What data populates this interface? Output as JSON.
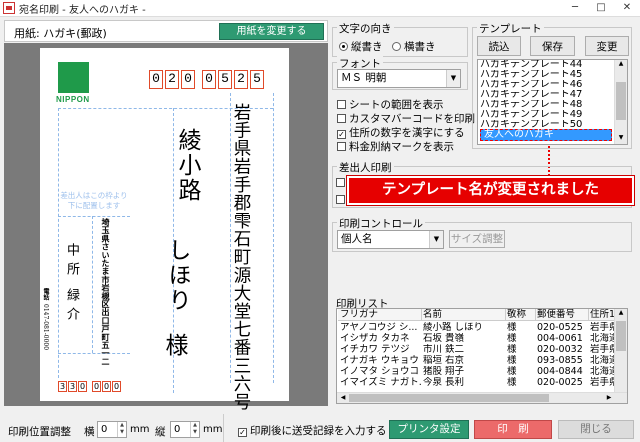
{
  "window": {
    "title": "宛名印刷 - 友人へのハガキ -",
    "controls": [
      "─",
      "□",
      "✕"
    ]
  },
  "preview": {
    "paper_label": "用紙: ハガキ(郵政)",
    "change_paper_button": "用紙を変更する",
    "logo_text": "NIPPON",
    "zip_digits": [
      "0",
      "2",
      "0",
      "0",
      "5",
      "2",
      "5"
    ],
    "address": "岩手県岩手郡雫石町源大堂七番三六号",
    "recipient_name_1": "綾小路",
    "recipient_name_2": "しほり",
    "honorific": "様",
    "guide_text": "差出人はこの枠より下に配置します",
    "sender_address": "埼玉県さいたま市岩槻区出口戸町五一二",
    "sender_name_1": "中所",
    "sender_name_2": "緑介",
    "side_text_1": "電話",
    "side_text_2": "0147-081-0000",
    "sender_zip": [
      "3",
      "3",
      "0",
      "0",
      "0",
      "0"
    ]
  },
  "direction": {
    "label": "文字の向き",
    "option_vertical": "縦書き",
    "option_horizontal": "横書き",
    "selected": "vertical"
  },
  "font": {
    "label": "フォント",
    "value": "ＭＳ 明朝"
  },
  "options": [
    {
      "label": "シートの範囲を表示",
      "checked": false
    },
    {
      "label": "カスタマバーコードを印刷",
      "checked": false
    },
    {
      "label": "住所の数字を漢字にする",
      "checked": true
    },
    {
      "label": "料金別納マークを表示",
      "checked": false
    }
  ],
  "template": {
    "label": "テンプレート",
    "load_button": "読込",
    "save_button": "保存",
    "change_button": "変更",
    "items": [
      "ハガキテンプレート44",
      "ハガキテンプレート45",
      "ハガキテンプレート46",
      "ハガキテンプレート47",
      "ハガキテンプレート48",
      "ハガキテンプレート49",
      "ハガキテンプレート50"
    ],
    "selected": "友人へのハガキ"
  },
  "notification": "テンプレート名が変更されました",
  "sender": {
    "label": "差出人印刷"
  },
  "print_control": {
    "label": "印刷コントロール",
    "mode": "個人名",
    "size_adjust_button": "サイズ調整"
  },
  "print_list": {
    "label": "印刷リスト",
    "columns": [
      "フリガナ",
      "名前",
      "敬称",
      "郵便番号",
      "住所1"
    ],
    "rows": [
      [
        "アヤノコウジ シ...",
        "綾小路 しほり",
        "様",
        "020-0525",
        "岩手県"
      ],
      [
        "イシザカ タカネ",
        "石坂 貴嶺",
        "様",
        "004-0061",
        "北海道"
      ],
      [
        "イチカワ テツジ",
        "市川 鉄二",
        "様",
        "020-0032",
        "岩手県"
      ],
      [
        "イナガキ ウキョウ",
        "稲垣 右京",
        "様",
        "093-0855",
        "北海道"
      ],
      [
        "イノマタ ショウコ",
        "猪股 翔子",
        "様",
        "004-0844",
        "北海道"
      ],
      [
        "イマイズミ ナガト...",
        "今泉 長利",
        "様",
        "020-0025",
        "岩手県"
      ],
      [
        "",
        "",
        "",
        "",
        ""
      ]
    ]
  },
  "bottom": {
    "position_label": "印刷位置調整",
    "horizontal_label": "横",
    "horizontal_value": "0",
    "vertical_label": "縦",
    "vertical_value": "0",
    "unit": "mm",
    "record_checkbox": "印刷後に送受記録を入力する",
    "record_checked": true,
    "printer_button": "プリンタ設定",
    "print_button": "印　刷",
    "close_button": "閉じる"
  }
}
